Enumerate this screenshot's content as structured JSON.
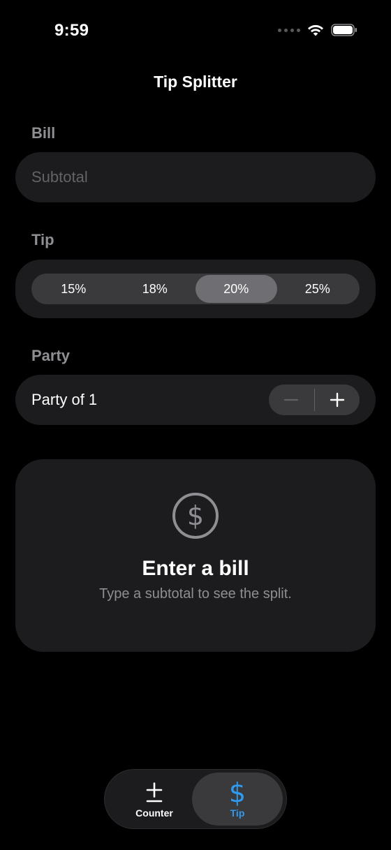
{
  "status_bar": {
    "time": "9:59"
  },
  "nav": {
    "title": "Tip Splitter"
  },
  "bill": {
    "section_label": "Bill",
    "placeholder": "Subtotal",
    "value": ""
  },
  "tip": {
    "section_label": "Tip",
    "options": [
      "15%",
      "18%",
      "20%",
      "25%"
    ],
    "selected": "20%"
  },
  "party": {
    "section_label": "Party",
    "label": "Party of 1"
  },
  "empty_state": {
    "icon": "dollar-circle-icon",
    "title": "Enter a bill",
    "subtitle": "Type a subtotal to see the split."
  },
  "tabbar": {
    "tabs": [
      {
        "label": "Counter",
        "icon": "plus-minus-icon",
        "active": false
      },
      {
        "label": "Tip",
        "icon": "dollar-icon",
        "active": true
      }
    ]
  },
  "colors": {
    "background": "#000000",
    "card": "#1c1c1e",
    "control": "#3a3a3c",
    "selected_segment": "#6e6e73",
    "secondary_text": "#8e8e93",
    "accent": "#2f9bf0"
  }
}
